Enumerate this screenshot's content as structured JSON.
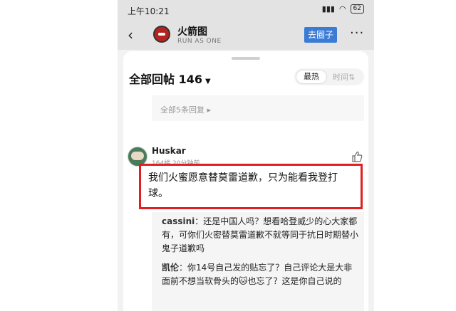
{
  "status_bar": {
    "time": "上午10:21",
    "signal": "▮▮▮",
    "wifi": "◠",
    "battery": "62"
  },
  "nav": {
    "title": "火箭图",
    "subtitle": "RUN AS ONE",
    "go_circle_label": "去圈子",
    "more": "···",
    "back": "‹"
  },
  "header": {
    "title": "全部回帖 146",
    "caret": "▼",
    "sort_hot": "最热",
    "sort_time": "时间⇅"
  },
  "replies_link": "全部5条回复 ▸",
  "post": {
    "username": "Huskar",
    "meta": "164楼 20分钟前",
    "content": "我们火蜜愿意替莫雷道歉，只为能看我登打球。"
  },
  "sub_replies": [
    {
      "user": "cassini",
      "text": "：还是中国人吗？想看哈登威少的心大家都有，可你们火密替莫雷道歉不就等同于抗日时期替小鬼子道歉吗"
    },
    {
      "user": "凯伦",
      "text": "：你14号自己发的贴忘了？自己评论大是大非面前不想当软骨头的🐱也忘了？这是你自己说的"
    }
  ]
}
